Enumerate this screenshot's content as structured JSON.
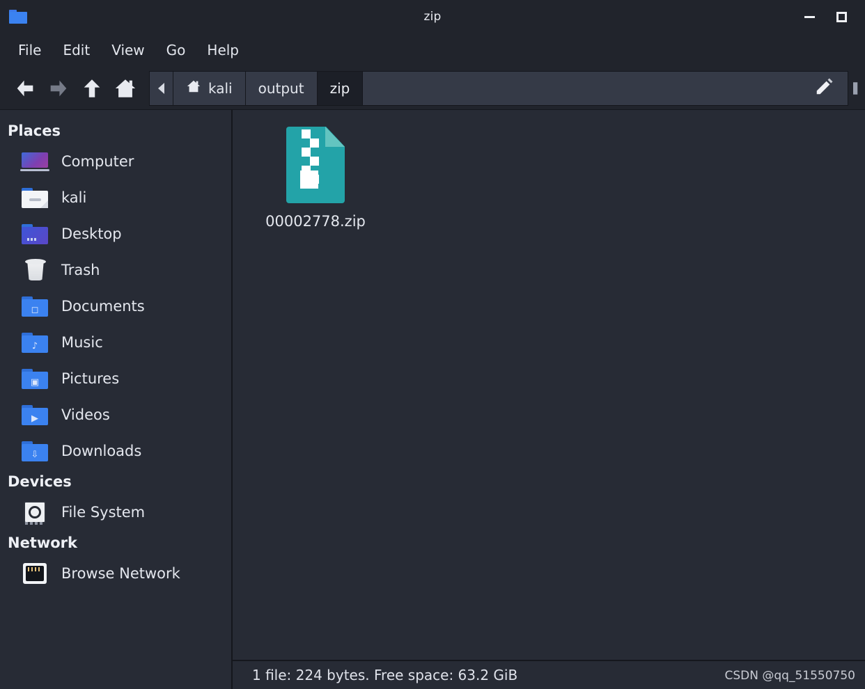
{
  "window": {
    "title": "zip",
    "folder_icon": "folder-icon",
    "minimize_label": "Minimize",
    "maximize_label": "Maximize"
  },
  "menubar": {
    "items": [
      {
        "label": "File",
        "name": "menu-file"
      },
      {
        "label": "Edit",
        "name": "menu-edit"
      },
      {
        "label": "View",
        "name": "menu-view"
      },
      {
        "label": "Go",
        "name": "menu-go"
      },
      {
        "label": "Help",
        "name": "menu-help"
      }
    ]
  },
  "toolbar": {
    "back_icon": "arrow-left-icon",
    "forward_icon": "arrow-right-icon",
    "up_icon": "arrow-up-icon",
    "home_icon": "home-icon",
    "edit_path_icon": "pencil-icon",
    "scroll_left_icon": "chevron-left-icon"
  },
  "breadcrumbs": [
    {
      "label": "kali",
      "icon": "home-icon",
      "active": false
    },
    {
      "label": "output",
      "icon": "",
      "active": false
    },
    {
      "label": "zip",
      "icon": "",
      "active": true
    }
  ],
  "sidebar": {
    "groups": [
      {
        "title": "Places",
        "items": [
          {
            "label": "Computer",
            "icon": "computer-icon"
          },
          {
            "label": "kali",
            "icon": "home-folder-icon"
          },
          {
            "label": "Desktop",
            "icon": "desktop-folder-icon"
          },
          {
            "label": "Trash",
            "icon": "trash-icon"
          },
          {
            "label": "Documents",
            "icon": "documents-folder-icon"
          },
          {
            "label": "Music",
            "icon": "music-folder-icon"
          },
          {
            "label": "Pictures",
            "icon": "pictures-folder-icon"
          },
          {
            "label": "Videos",
            "icon": "videos-folder-icon"
          },
          {
            "label": "Downloads",
            "icon": "downloads-folder-icon"
          }
        ]
      },
      {
        "title": "Devices",
        "items": [
          {
            "label": "File System",
            "icon": "harddisk-icon"
          }
        ]
      },
      {
        "title": "Network",
        "items": [
          {
            "label": "Browse Network",
            "icon": "network-icon"
          }
        ]
      }
    ]
  },
  "files": [
    {
      "name": "00002778.zip",
      "icon": "zip-archive-icon"
    }
  ],
  "statusbar": {
    "text": "1 file: 224 bytes. Free space: 63.2 GiB"
  },
  "watermark": {
    "text": "CSDN @qq_51550750"
  },
  "colors": {
    "window_bg": "#21242c",
    "pane_bg": "#272b35",
    "crumb_bg": "#353a47",
    "crumb_active_bg": "#1c1f27",
    "text": "#e4e7ee",
    "accent_folder": "#3b82f0",
    "zip_teal": "#23a3a8"
  }
}
